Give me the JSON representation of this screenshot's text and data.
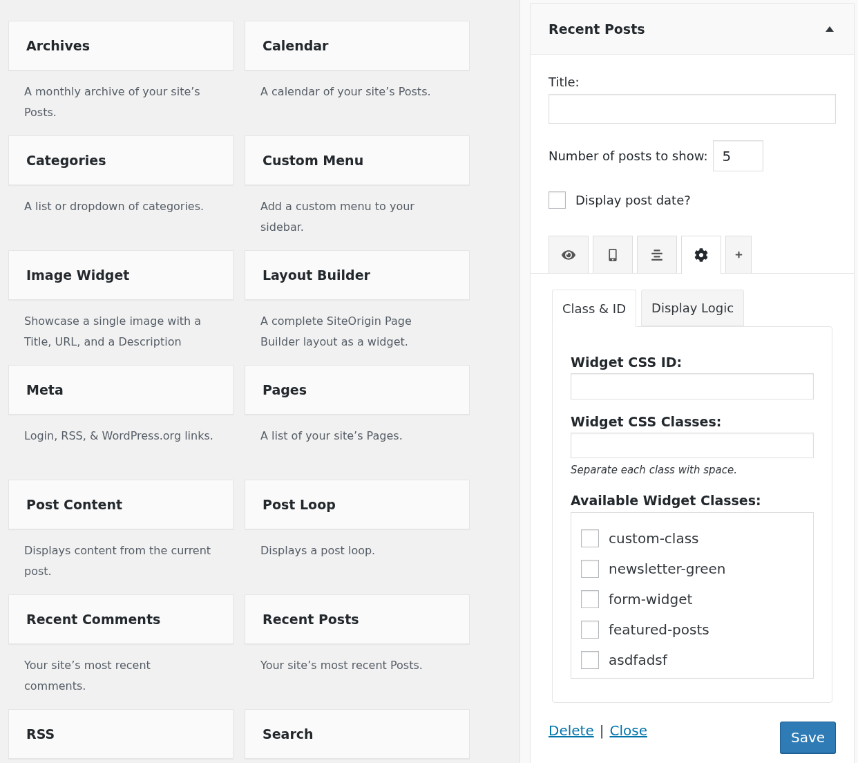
{
  "widgets": [
    {
      "title": "Archives",
      "description": "A monthly archive of your site’s Posts."
    },
    {
      "title": "Calendar",
      "description": "A calendar of your site’s Posts."
    },
    {
      "title": "Categories",
      "description": "A list or dropdown of categories."
    },
    {
      "title": "Custom Menu",
      "description": "Add a custom menu to your sidebar."
    },
    {
      "title": "Image Widget",
      "description": "Showcase a single image with a Title, URL, and a Description"
    },
    {
      "title": "Layout Builder",
      "description": "A complete SiteOrigin Page Builder layout as a widget."
    },
    {
      "title": "Meta",
      "description": "Login, RSS, & WordPress.org links."
    },
    {
      "title": "Pages",
      "description": "A list of your site’s Pages."
    },
    {
      "title": "Post Content",
      "description": "Displays content from the current post."
    },
    {
      "title": "Post Loop",
      "description": "Displays a post loop."
    },
    {
      "title": "Recent Comments",
      "description": "Your site’s most recent comments."
    },
    {
      "title": "Recent Posts",
      "description": "Your site’s most recent Posts."
    },
    {
      "title": "RSS"
    },
    {
      "title": "Search"
    }
  ],
  "panel": {
    "title": "Recent Posts",
    "expanded": true,
    "fields": [
      {
        "kind": "text",
        "label": "Title:"
      },
      {
        "kind": "number",
        "label": "Number of posts to show:",
        "value": "5"
      },
      {
        "kind": "checkbox",
        "label": "Display post date?",
        "checked": false
      }
    ],
    "icon_tabs": [
      {
        "kind": "eye",
        "selected": false
      },
      {
        "kind": "phone",
        "selected": false
      },
      {
        "kind": "align",
        "selected": false
      },
      {
        "kind": "gear",
        "selected": true
      },
      {
        "kind": "plus",
        "selected": false
      }
    ],
    "tabs": [
      {
        "label": "Class & ID",
        "selected": true
      },
      {
        "label": "Display Logic",
        "selected": false
      }
    ],
    "class_id": {
      "id_label": "Widget CSS ID:",
      "classes_label": "Widget CSS Classes:",
      "hint": "Separate each class with space.",
      "available_label": "Available Widget Classes:",
      "available": [
        {
          "label": "custom-class",
          "checked": false
        },
        {
          "label": "newsletter-green",
          "checked": false
        },
        {
          "label": "form-widget",
          "checked": false
        },
        {
          "label": "featured-posts",
          "checked": false
        },
        {
          "label": "asdfadsf",
          "checked": false
        }
      ]
    },
    "footer": {
      "links": [
        "Delete",
        "Close"
      ],
      "separator": "|",
      "save": "Save"
    }
  }
}
